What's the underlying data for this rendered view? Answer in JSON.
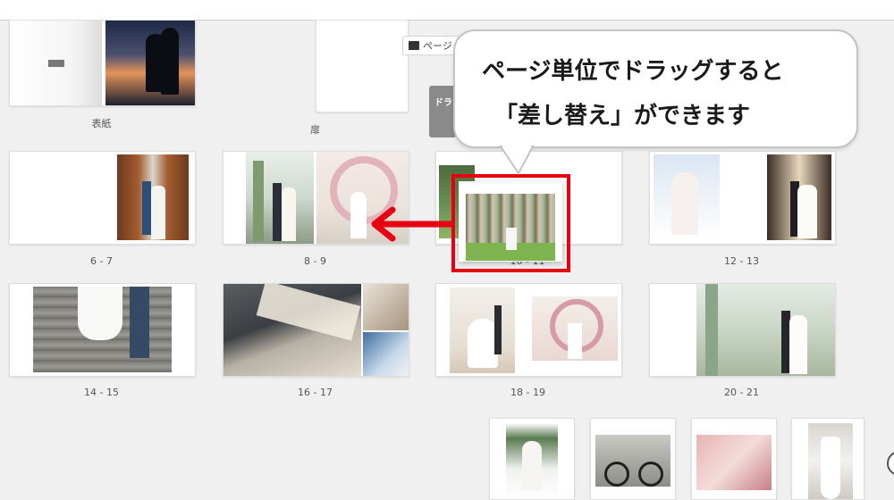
{
  "callout": {
    "line1": "ページ単位でドラッグすると",
    "line2": "「差し替え」ができます",
    "accent_color": "#e60012"
  },
  "toolbar": {
    "page_chip_label": "ページ",
    "page_chip_icon": "book-icon",
    "drag_tab_label": "ドラ"
  },
  "spreads": [
    {
      "label": "表紙"
    },
    {
      "label": "扉"
    },
    {
      "label": "6 - 7"
    },
    {
      "label": "8 - 9"
    },
    {
      "label": "12 - 13"
    },
    {
      "label": "14 - 15"
    },
    {
      "label": "16 - 17"
    },
    {
      "label": "18 - 19"
    },
    {
      "label": "20 - 21"
    }
  ],
  "dragged_label_fragment": "10 - 11",
  "icons": {
    "arrow": "arrow-left-icon",
    "help": "help-circle-icon"
  }
}
